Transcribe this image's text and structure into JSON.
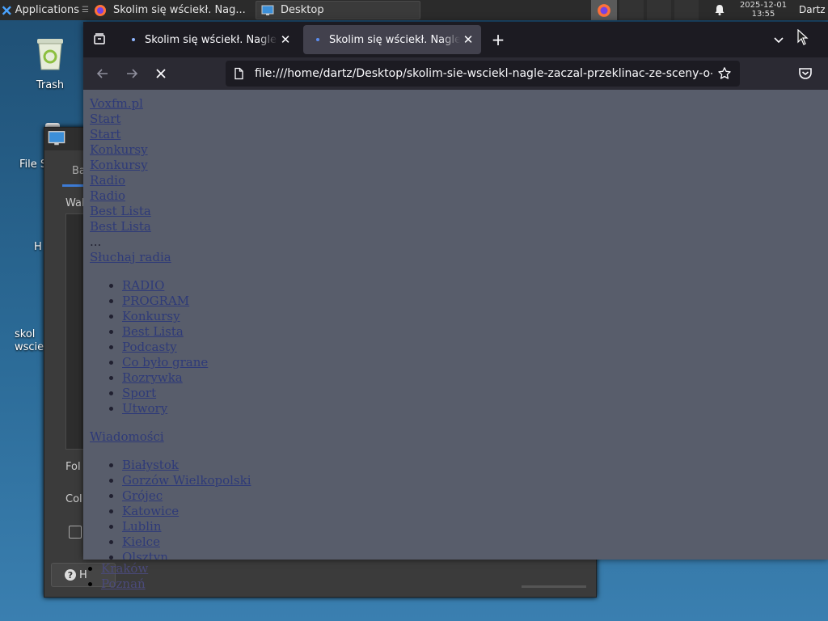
{
  "panel": {
    "applications_label": "Applications",
    "applications_suffix": "☰",
    "task_firefox_label": "Skolim się wściekł. Nag...",
    "task_desktop_label": "Desktop",
    "clock_date": "2025-12-01",
    "clock_time": "13:55",
    "user": "Dartz"
  },
  "desktop": {
    "icons": [
      {
        "label": "Trash"
      },
      {
        "label": "File S"
      },
      {
        "label": "H"
      },
      {
        "label": "skol\nwscie"
      }
    ]
  },
  "bg_dialog": {
    "tab_label": "Ba",
    "wall_label": "Wal",
    "folder_label": "Fol",
    "color_label": "Col",
    "help_label": "H"
  },
  "browser": {
    "tabs": [
      {
        "label": "Skolim się wściekł. Nagle zaczął przeklinać"
      },
      {
        "label": "Skolim się wściekł. Nagle zaczął przeklinać"
      }
    ],
    "url": "file:///home/dartz/Desktop/skolim-sie-wsciekl-nagle-zaczal-przeklinac-ze-sceny-o-",
    "content": {
      "top_links": [
        "Voxfm.pl",
        "Start",
        "Start",
        "Konkursy",
        "Konkursy",
        "Radio",
        "Radio",
        "Best Lista",
        "Best Lista"
      ],
      "ellipsis": "...",
      "listen_link": "Słuchaj radia",
      "menu_items": [
        "RADIO",
        "PROGRAM",
        "Konkursy",
        "Best Lista",
        "Podcasty",
        "Co było grane",
        "Rozrywka",
        "Sport",
        "Utwory"
      ],
      "news_link": "Wiadomości",
      "city_items": [
        "Białystok",
        "Gorzów Wielkopolski",
        "Grójec",
        "Katowice",
        "Lublin",
        "Kielce",
        "Olsztyn"
      ],
      "overflow_items": [
        "Kraków",
        "Poznań"
      ]
    }
  }
}
